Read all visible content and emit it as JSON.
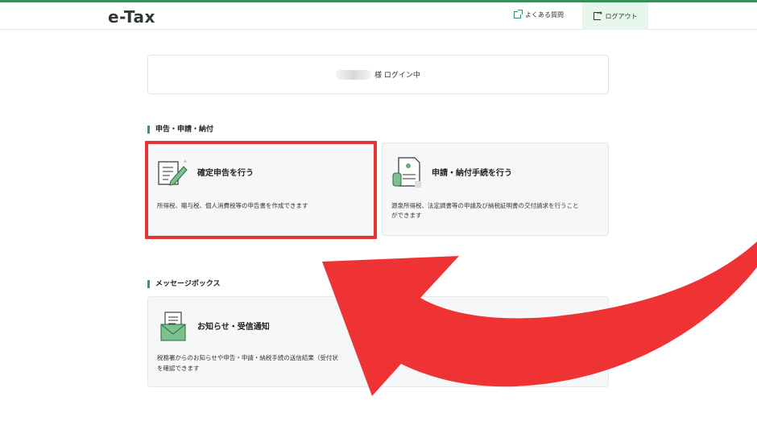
{
  "header": {
    "logo": "e-Tax",
    "faq_label": "よくある質問",
    "logout_label": "ログアウト"
  },
  "login": {
    "status_text": "様 ログイン中"
  },
  "sections": {
    "filing": {
      "heading": "申告・申請・納付",
      "cards": [
        {
          "title": "確定申告を行う",
          "desc": "所得税、贈与税、個人消費税等の申告書を作成できます"
        },
        {
          "title": "申請・納付手続を行う",
          "desc_line1": "源泉所得税、法定調書等の申請及び納税証明書の交付請求を行うこと",
          "desc_line2": "ができます"
        }
      ]
    },
    "messages": {
      "heading": "メッセージボックス",
      "card": {
        "title": "お知らせ・受信通知",
        "desc_line1": "税務署からのお知らせや申告・申請・納税手続の送信結果（受付状",
        "desc_line2": "を確認できます"
      }
    }
  },
  "colors": {
    "accent_green": "#3a9a5e",
    "highlight_red": "#e53235",
    "arrow_red": "#ef3334"
  },
  "icons": [
    "external-link-icon",
    "logout-icon",
    "tax-return-document-icon",
    "application-document-icon",
    "message-envelope-icon",
    "curved-arrow-annotation"
  ]
}
